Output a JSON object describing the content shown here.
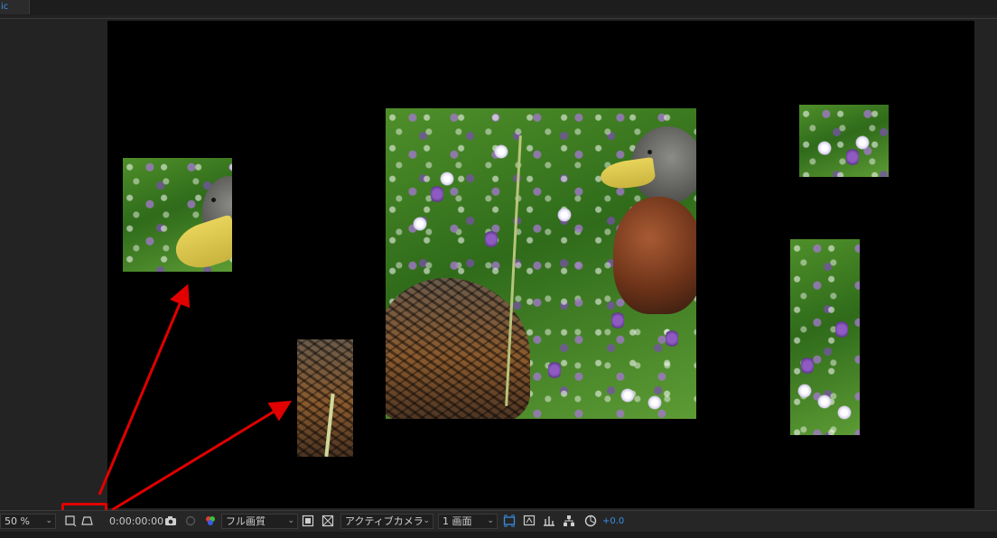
{
  "top_tab": {
    "label": "ic"
  },
  "statusbar": {
    "zoom": "50 %",
    "timecode": "0:00:00:00",
    "resolution": "フル画質",
    "camera": "アクティブカメラ",
    "views": "1 画面",
    "exposure": "+0.0"
  },
  "colors": {
    "accent": "#3a8ee6",
    "annotation_red": "#e00000",
    "comp_background": "#000000"
  },
  "icons": [
    "region-of-interest-icon",
    "toggle-mask-path-icon",
    "snapshot-camera-icon",
    "show-snapshot-icon",
    "channel-rgb-icon",
    "toggle-transparency-grid-icon",
    "fast-preview-icon",
    "3d-view-icon",
    "flowchart-icon",
    "reset-exposure-icon"
  ]
}
